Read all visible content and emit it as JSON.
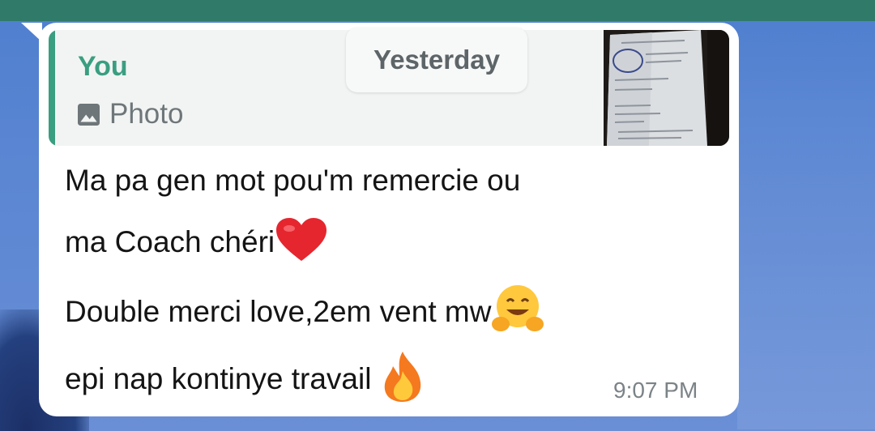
{
  "quoted_message": {
    "author": "You",
    "type_label": "Photo",
    "type_icon": "photo-icon"
  },
  "date_divider": "Yesterday",
  "message": {
    "lines": [
      "Ma pa gen mot pou'm remercie ou",
      "ma Coach chéri",
      "Double merci love,2em vent mw",
      "epi nap kontinye travail "
    ],
    "emojis": [
      "red-heart-icon",
      "hugging-face-icon",
      "fire-icon"
    ],
    "time": "9:07 PM"
  },
  "colors": {
    "accent": "#3a9e80",
    "topbar": "#2f7a68",
    "wallpaper": "#5b86d2",
    "bubble": "#ffffff"
  }
}
